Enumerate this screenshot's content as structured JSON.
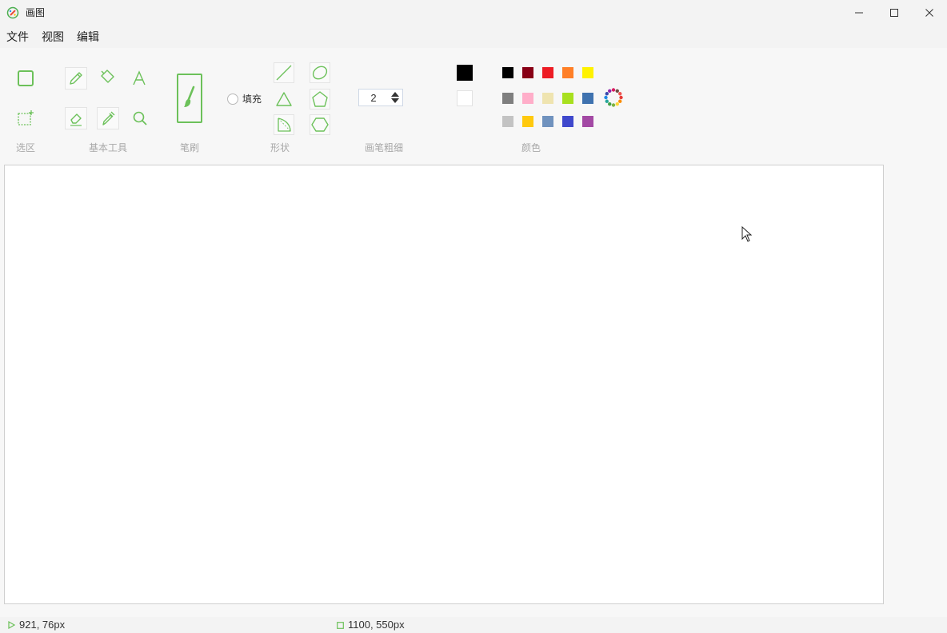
{
  "window": {
    "title": "画图",
    "app_icon": "paint-app-icon"
  },
  "window_controls": {
    "minimize_icon": "minimize-icon",
    "maximize_icon": "maximize-icon",
    "close_icon": "close-icon"
  },
  "menu": {
    "file": "文件",
    "view": "视图",
    "edit": "编辑"
  },
  "ribbon": {
    "groups": {
      "selection": "选区",
      "basic_tools": "基本工具",
      "brush": "笔刷",
      "shapes": "形状",
      "pen_width": "画笔粗细",
      "colors": "颜色"
    },
    "fill_label": "填充",
    "fill_checked": false,
    "pen_width_value": "2",
    "tools": {
      "selection": [
        "rectangle-select-icon",
        "free-select-icon"
      ],
      "basic": [
        "pencil-icon",
        "fill-bucket-icon",
        "text-icon",
        "eraser-icon",
        "color-picker-icon",
        "magnifier-icon"
      ],
      "brush": "brush-icon",
      "shapes": [
        "line-icon",
        "ellipse-icon",
        "triangle-icon",
        "pentagon-icon",
        "right-triangle-icon",
        "hexagon-icon"
      ]
    },
    "primary_color": "#000000",
    "secondary_color": "#ffffff",
    "palette": [
      [
        "#000000",
        "#880015",
        "#ed1c24",
        "#ff7f27",
        "#fff200"
      ],
      [
        "#7f7f7f",
        "#ffaec9",
        "#efe4b0",
        "#a8e01f",
        "#3f72af"
      ],
      [
        "#c3c3c3",
        "#ffc90e",
        "#7092be",
        "#3f48cc",
        "#a349a4"
      ]
    ],
    "edit_colors_icon": "color-wheel-icon"
  },
  "accent_color": "#6cc15a",
  "status": {
    "cursor_position": "921, 76px",
    "canvas_size": "1100, 550px",
    "cursor_icon": "cursor-position-icon",
    "size_icon": "canvas-size-icon"
  }
}
